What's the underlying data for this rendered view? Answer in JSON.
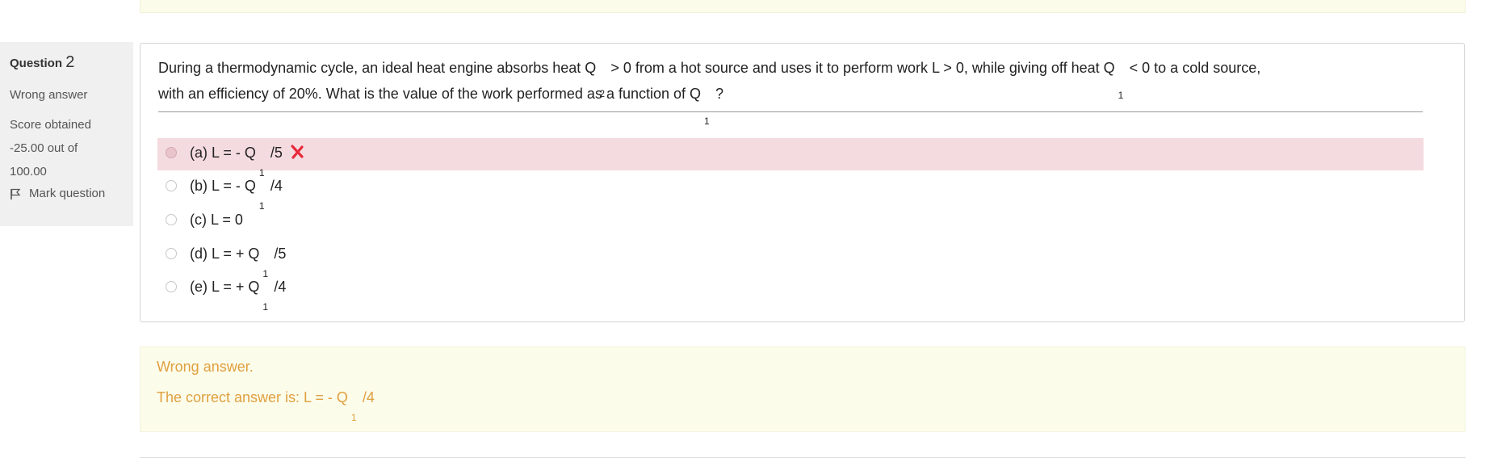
{
  "question": {
    "heading_prefix": "Question",
    "number": "2",
    "status": "Wrong answer",
    "score_label": "Score obtained",
    "score_value": "-25.00 out of",
    "score_max": "100.00",
    "flag_label": "Mark question",
    "text_part1": "During a thermodynamic cycle, an ideal heat engine absorbs heat Q",
    "text_sub2": "2",
    "text_part2": "> 0 from a hot source and uses it to perform work L > 0, while giving off heat Q",
    "text_sub1": "1",
    "text_part3": "< 0 to a cold source,",
    "text_line2a": "with an efficiency of 20%. What is the value of the work performed as a function of Q",
    "text_line2_sub": "1",
    "text_line2b": "?"
  },
  "answers": [
    {
      "label": "(a) L = - Q",
      "sub": "1",
      "suffix": "/5",
      "state": "incorrect"
    },
    {
      "label": "(b) L = - Q",
      "sub": "1",
      "suffix": "/4",
      "state": "normal"
    },
    {
      "label": "(c) L = 0",
      "sub": "",
      "suffix": "",
      "state": "normal"
    },
    {
      "label": "(d) L = + Q",
      "sub": "1",
      "suffix": "/5",
      "state": "normal"
    },
    {
      "label": "(e) L = + Q",
      "sub": "1",
      "suffix": "/4",
      "state": "normal"
    }
  ],
  "feedback": {
    "title": "Wrong answer.",
    "correct_prefix": "The correct answer is: L = - Q",
    "correct_sub": "1",
    "correct_suffix": "/4"
  },
  "colors": {
    "incorrect_bg": "#f4dbe0",
    "feedback_bg": "#fcfcea",
    "feedback_text": "#e0a040",
    "x_mark": "#e8293b"
  },
  "icons": {
    "flag": "flag-icon",
    "wrong": "cross-icon"
  }
}
